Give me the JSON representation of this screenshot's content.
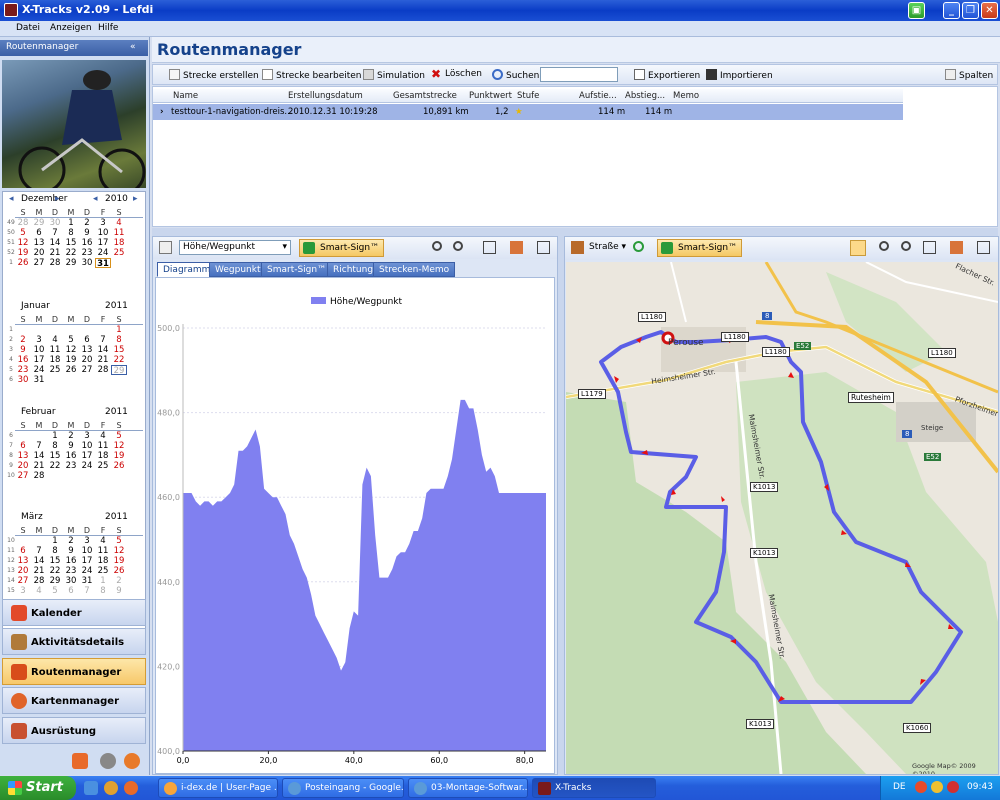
{
  "window": {
    "title": "X-Tracks v2.09 - Lefdi"
  },
  "menu": [
    "Datei",
    "Anzeigen",
    "Hilfe"
  ],
  "sidebar": {
    "header": "Routenmanager",
    "collapse": "«",
    "calendars": [
      {
        "month": "Dezember",
        "year": "2010",
        "weekdays": [
          "S",
          "M",
          "D",
          "M",
          "D",
          "F",
          "S"
        ],
        "weeks": [
          [
            "49",
            "28",
            "29",
            "30",
            "1",
            "2",
            "3",
            "4"
          ],
          [
            "50",
            "5",
            "6",
            "7",
            "8",
            "9",
            "10",
            "11"
          ],
          [
            "51",
            "12",
            "13",
            "14",
            "15",
            "16",
            "17",
            "18"
          ],
          [
            "52",
            "19",
            "20",
            "21",
            "22",
            "23",
            "24",
            "25"
          ],
          [
            "1",
            "26",
            "27",
            "28",
            "29",
            "30",
            "31",
            ""
          ]
        ]
      },
      {
        "month": "Januar",
        "year": "2011",
        "weekdays": [
          "S",
          "M",
          "D",
          "M",
          "D",
          "F",
          "S"
        ],
        "weeks": [
          [
            "1",
            "",
            "",
            "",
            "",
            "",
            "",
            "1"
          ],
          [
            "2",
            "2",
            "3",
            "4",
            "5",
            "6",
            "7",
            "8"
          ],
          [
            "3",
            "9",
            "10",
            "11",
            "12",
            "13",
            "14",
            "15"
          ],
          [
            "4",
            "16",
            "17",
            "18",
            "19",
            "20",
            "21",
            "22"
          ],
          [
            "5",
            "23",
            "24",
            "25",
            "26",
            "27",
            "28",
            "29"
          ],
          [
            "6",
            "30",
            "31",
            "",
            "",
            "",
            "",
            ""
          ]
        ]
      },
      {
        "month": "Februar",
        "year": "2011",
        "weekdays": [
          "S",
          "M",
          "D",
          "M",
          "D",
          "F",
          "S"
        ],
        "weeks": [
          [
            "6",
            "",
            "",
            "1",
            "2",
            "3",
            "4",
            "5"
          ],
          [
            "7",
            "6",
            "7",
            "8",
            "9",
            "10",
            "11",
            "12"
          ],
          [
            "8",
            "13",
            "14",
            "15",
            "16",
            "17",
            "18",
            "19"
          ],
          [
            "9",
            "20",
            "21",
            "22",
            "23",
            "24",
            "25",
            "26"
          ],
          [
            "10",
            "27",
            "28",
            "",
            "",
            "",
            "",
            ""
          ]
        ]
      },
      {
        "month": "März",
        "year": "2011",
        "weekdays": [
          "S",
          "M",
          "D",
          "M",
          "D",
          "F",
          "S"
        ],
        "weeks": [
          [
            "10",
            "",
            "",
            "1",
            "2",
            "3",
            "4",
            "5"
          ],
          [
            "11",
            "6",
            "7",
            "8",
            "9",
            "10",
            "11",
            "12"
          ],
          [
            "12",
            "13",
            "14",
            "15",
            "16",
            "17",
            "18",
            "19"
          ],
          [
            "13",
            "20",
            "21",
            "22",
            "23",
            "24",
            "25",
            "26"
          ],
          [
            "14",
            "27",
            "28",
            "29",
            "30",
            "31",
            "1",
            "2"
          ],
          [
            "15",
            "3",
            "4",
            "5",
            "6",
            "7",
            "8",
            "9"
          ]
        ]
      }
    ],
    "nav": [
      "Kalender",
      "Aktivitätsdetails",
      "Routenmanager",
      "Kartenmanager",
      "Ausrüstung"
    ],
    "active_nav": "Routenmanager"
  },
  "main": {
    "title": "Routenmanager",
    "toolbar": {
      "create": "Strecke erstellen",
      "edit": "Strecke bearbeiten",
      "simulation": "Simulation",
      "delete": "Löschen",
      "search": "Suchen",
      "search_value": "",
      "export": "Exportieren",
      "import": "Importieren",
      "columns": "Spalten"
    },
    "table": {
      "headers": [
        "Name",
        "Erstellungsdatum",
        "Gesamtstrecke",
        "Punktwert",
        "Stufe",
        "Aufstie...",
        "Abstieg...",
        "Memo"
      ],
      "rows": [
        {
          "name": "testtour-1-navigation-dreis...",
          "date": "2010.12.31 10:19:28",
          "distance": "10,891 km",
          "score": "1,2",
          "level": "★",
          "ascent": "114 m",
          "descent": "114 m",
          "memo": ""
        }
      ]
    }
  },
  "chart_panel": {
    "select_value": "Höhe/Wegpunkt",
    "smart_sign": "Smart-Sign™",
    "tabs": [
      "Diagramm",
      "Wegpunkt",
      "Smart-Sign™",
      "Richtung",
      "Strecken-Memo"
    ],
    "active_tab": "Diagramm"
  },
  "chart_data": {
    "type": "area",
    "legend": "Höhe/Wegpunkt",
    "legend_position": "top",
    "fill": "#8080f0",
    "ylim": [
      400,
      500
    ],
    "xlim": [
      0,
      85
    ],
    "yticks": [
      "400,0",
      "420,0",
      "440,0",
      "460,0",
      "480,0",
      "500,0"
    ],
    "xticks": [
      "0,0",
      "20,0",
      "40,0",
      "60,0",
      "80,0"
    ],
    "x": [
      0,
      1,
      2,
      3,
      4,
      5,
      6,
      7,
      8,
      9,
      10,
      11,
      12,
      13,
      14,
      15,
      16,
      17,
      18,
      19,
      20,
      21,
      22,
      23,
      24,
      25,
      26,
      27,
      28,
      29,
      30,
      31,
      32,
      33,
      34,
      35,
      36,
      37,
      38,
      39,
      40,
      41,
      42,
      43,
      44,
      45,
      46,
      47,
      48,
      49,
      50,
      51,
      52,
      53,
      54,
      55,
      56,
      57,
      58,
      59,
      60,
      61,
      62,
      63,
      64,
      65,
      66,
      67,
      68,
      69,
      70,
      71,
      72,
      73,
      74,
      75,
      76,
      77,
      78,
      79,
      80,
      81,
      82,
      83,
      84,
      85
    ],
    "y": [
      461,
      461,
      461,
      459,
      458,
      459,
      459,
      458,
      459,
      459,
      460,
      461,
      463,
      471,
      471,
      472,
      474,
      476,
      472,
      462,
      461,
      460,
      460,
      458,
      456,
      451,
      449,
      446,
      443,
      441,
      437,
      432,
      430,
      428,
      426,
      424,
      422,
      419,
      421,
      429,
      433,
      432,
      463,
      467,
      465,
      451,
      441,
      441,
      441,
      443,
      446,
      447,
      447,
      449,
      452,
      452,
      455,
      461,
      462,
      462,
      462,
      462,
      465,
      469,
      476,
      483,
      483,
      481,
      481,
      476,
      470,
      466,
      467,
      465,
      461,
      461,
      461,
      461,
      461,
      461,
      461,
      461,
      461,
      461,
      461,
      461
    ]
  },
  "map_panel": {
    "road_label": "Straße",
    "smart_sign": "Smart-Sign™",
    "labels": [
      "Perouse",
      "Heimsheimer Str.",
      "Malmsheimer Str.",
      "Malmsheimer Str.",
      "Rutesheim",
      "Steige",
      "Flacher Str.",
      "Pforzheimer"
    ],
    "road_badges": [
      "L1180",
      "L1180",
      "L1180",
      "L1180",
      "L1179",
      "K1013",
      "K1013",
      "K1013",
      "K1060",
      "E52",
      "E52",
      "8",
      "8"
    ],
    "copyright": "Google Map© 2009 ©2010"
  },
  "taskbar": {
    "start": "Start",
    "tasks": [
      "i-dex.de | User-Page ...",
      "Posteingang - Google...",
      "03-Montage-Softwar...",
      "X-Tracks"
    ],
    "active_task": "X-Tracks",
    "lang": "DE",
    "clock": "09:43"
  }
}
